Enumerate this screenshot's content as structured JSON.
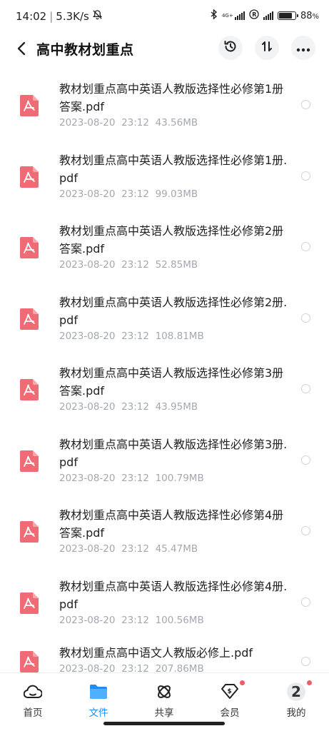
{
  "status_bar": {
    "time": "14:02",
    "separator": "|",
    "speed": "5.3K/s",
    "network": "4G+",
    "battery": "88",
    "battery_unit": "%",
    "battery_level": 0.88
  },
  "header": {
    "title": "高中教材划重点"
  },
  "files": [
    {
      "name": "教材划重点高中英语人教版选择性必修第1册答案.pdf",
      "date": "2023-08-20",
      "time": "23:12",
      "size": "43.56MB"
    },
    {
      "name": "教材划重点高中英语人教版选择性必修第1册.pdf",
      "date": "2023-08-20",
      "time": "23:12",
      "size": "99.03MB"
    },
    {
      "name": "教材划重点高中英语人教版选择性必修第2册答案.pdf",
      "date": "2023-08-20",
      "time": "23:12",
      "size": "52.85MB"
    },
    {
      "name": "教材划重点高中英语人教版选择性必修第2册.pdf",
      "date": "2023-08-20",
      "time": "23:12",
      "size": "108.81MB"
    },
    {
      "name": "教材划重点高中英语人教版选择性必修第3册答案.pdf",
      "date": "2023-08-20",
      "time": "23:12",
      "size": "43.95MB"
    },
    {
      "name": "教材划重点高中英语人教版选择性必修第3册.pdf",
      "date": "2023-08-20",
      "time": "23:12",
      "size": "100.79MB"
    },
    {
      "name": "教材划重点高中英语人教版选择性必修第4册答案.pdf",
      "date": "2023-08-20",
      "time": "23:12",
      "size": "45.47MB"
    },
    {
      "name": "教材划重点高中英语人教版选择性必修第4册.pdf",
      "date": "2023-08-20",
      "time": "23:12",
      "size": "100.56MB"
    },
    {
      "name": "教材划重点高中语文人教版必修上.pdf",
      "date": "2023-08-20",
      "time": "23:12",
      "size": "207.86MB"
    }
  ],
  "nav": {
    "items": [
      {
        "label": "首页",
        "icon": "home-cloud-icon"
      },
      {
        "label": "文件",
        "icon": "folder-icon"
      },
      {
        "label": "共享",
        "icon": "share-icon"
      },
      {
        "label": "会员",
        "icon": "vip-icon"
      },
      {
        "label": "我的",
        "icon": "avatar-icon"
      }
    ],
    "avatar_text": "2"
  },
  "colors": {
    "accent": "#1f8cf2",
    "pdf": "#f06b76",
    "dot": "#f25a67"
  }
}
